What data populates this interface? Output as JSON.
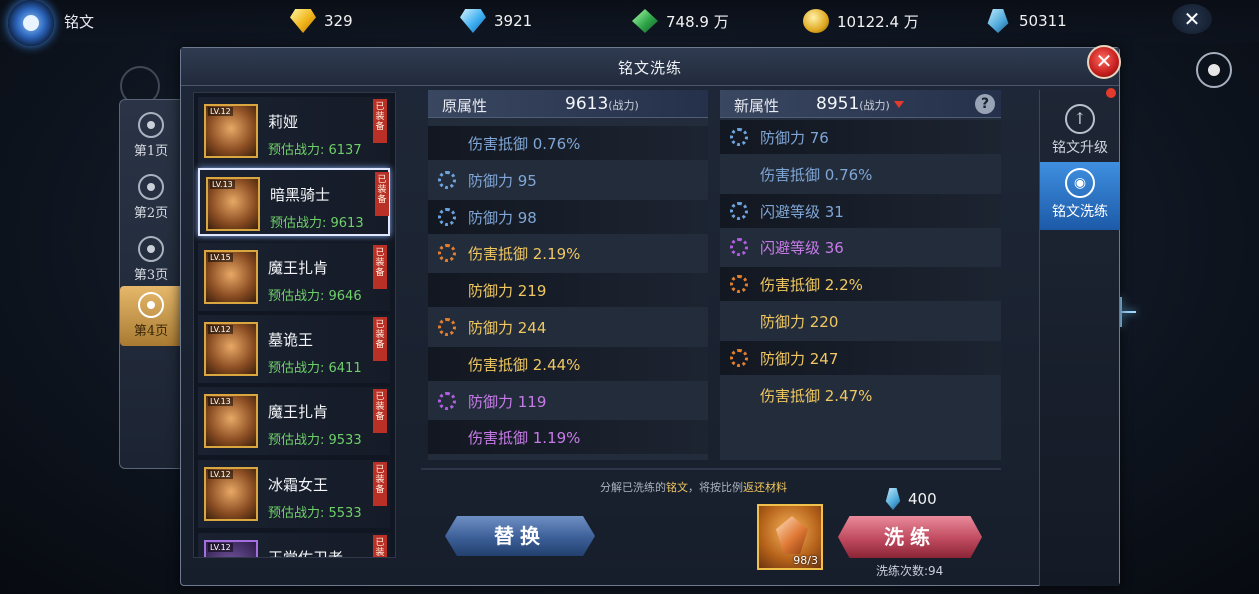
{
  "topbar": {
    "title": "铭文",
    "resources": [
      {
        "icon": "gold-diamond-icon",
        "value": "329"
      },
      {
        "icon": "blue-diamond-icon",
        "value": "3921"
      },
      {
        "icon": "green-crystal-icon",
        "value": "748.9 万"
      },
      {
        "icon": "gold-coin-icon",
        "value": "10122.4 万"
      },
      {
        "icon": "blue-crystal-icon",
        "value": "50311"
      }
    ]
  },
  "page_tabs": [
    {
      "label": "第1页",
      "active": false
    },
    {
      "label": "第2页",
      "active": false
    },
    {
      "label": "第3页",
      "active": false
    },
    {
      "label": "第4页",
      "active": true
    }
  ],
  "panel": {
    "title": "铭文洗练"
  },
  "characters": [
    {
      "name": "莉娅",
      "power_label": "预估战力: 6137",
      "level": "LV.12",
      "tag": "已装备",
      "selected": false
    },
    {
      "name": "暗黑骑士",
      "power_label": "预估战力: 9613",
      "level": "LV.13",
      "tag": "已装备",
      "selected": true
    },
    {
      "name": "魔王扎肯",
      "power_label": "预估战力: 9646",
      "level": "LV.15",
      "tag": "已装备",
      "selected": false
    },
    {
      "name": "墓诡王",
      "power_label": "预估战力: 6411",
      "level": "LV.12",
      "tag": "已装备",
      "selected": false
    },
    {
      "name": "魔王扎肯",
      "power_label": "预估战力: 9533",
      "level": "LV.13",
      "tag": "已装备",
      "selected": false
    },
    {
      "name": "冰霜女王",
      "power_label": "预估战力: 5533",
      "level": "LV.12",
      "tag": "已装备",
      "selected": false
    },
    {
      "name": "王党佐卫者",
      "power_label": "",
      "level": "LV.12",
      "tag": "已装备",
      "selected": false
    }
  ],
  "original": {
    "label": "原属性",
    "power": "9613",
    "unit": "(战力)",
    "rows": [
      {
        "text": "伤害抵御 0.76%",
        "color": "blue",
        "icon": ""
      },
      {
        "text": "防御力 95",
        "color": "blue",
        "icon": "blue-swirl-icon"
      },
      {
        "text": "防御力 98",
        "color": "blue",
        "icon": "blue-swirl-icon"
      },
      {
        "text": "伤害抵御 2.19%",
        "color": "gold",
        "icon": "gold-swirl-icon"
      },
      {
        "text": "防御力 219",
        "color": "gold",
        "icon": ""
      },
      {
        "text": "防御力 244",
        "color": "gold",
        "icon": "gold-swirl-icon"
      },
      {
        "text": "伤害抵御 2.44%",
        "color": "gold",
        "icon": ""
      },
      {
        "text": "防御力 119",
        "color": "purple",
        "icon": "purple-swirl-icon"
      },
      {
        "text": "伤害抵御 1.19%",
        "color": "purple",
        "icon": ""
      }
    ]
  },
  "new": {
    "label": "新属性",
    "power": "8951",
    "unit": "(战力)",
    "help": "?",
    "rows": [
      {
        "text": "防御力 76",
        "color": "blue",
        "icon": "blue-swirl-icon"
      },
      {
        "text": "伤害抵御 0.76%",
        "color": "blue",
        "icon": ""
      },
      {
        "text": "闪避等级 31",
        "color": "blue",
        "icon": "blue-swirl-icon"
      },
      {
        "text": "闪避等级 36",
        "color": "purple",
        "icon": "purple-swirl-icon"
      },
      {
        "text": "伤害抵御 2.2%",
        "color": "gold",
        "icon": "gold-swirl-icon"
      },
      {
        "text": "防御力 220",
        "color": "gold",
        "icon": ""
      },
      {
        "text": "防御力 247",
        "color": "gold",
        "icon": "gold-swirl-icon"
      },
      {
        "text": "伤害抵御 2.47%",
        "color": "gold",
        "icon": ""
      }
    ]
  },
  "footer": {
    "decompose_pre": "分解已洗练的",
    "decompose_hl1": "铭文",
    "decompose_mid": "，将按比例",
    "decompose_hl2": "返还材料",
    "replace_label": "替换",
    "wash_label": "洗练",
    "material_count": "98/3",
    "cost": "400",
    "wash_count": "洗练次数:94"
  },
  "right_tabs": [
    {
      "label": "铭文升级",
      "active": false
    },
    {
      "label": "铭文洗练",
      "active": true
    }
  ],
  "colors": {
    "blue": "#7fa6d6",
    "gold": "#f0c761",
    "purple": "#c77be8",
    "power_green": "#6fd06a",
    "equip_red": "#b93026"
  }
}
